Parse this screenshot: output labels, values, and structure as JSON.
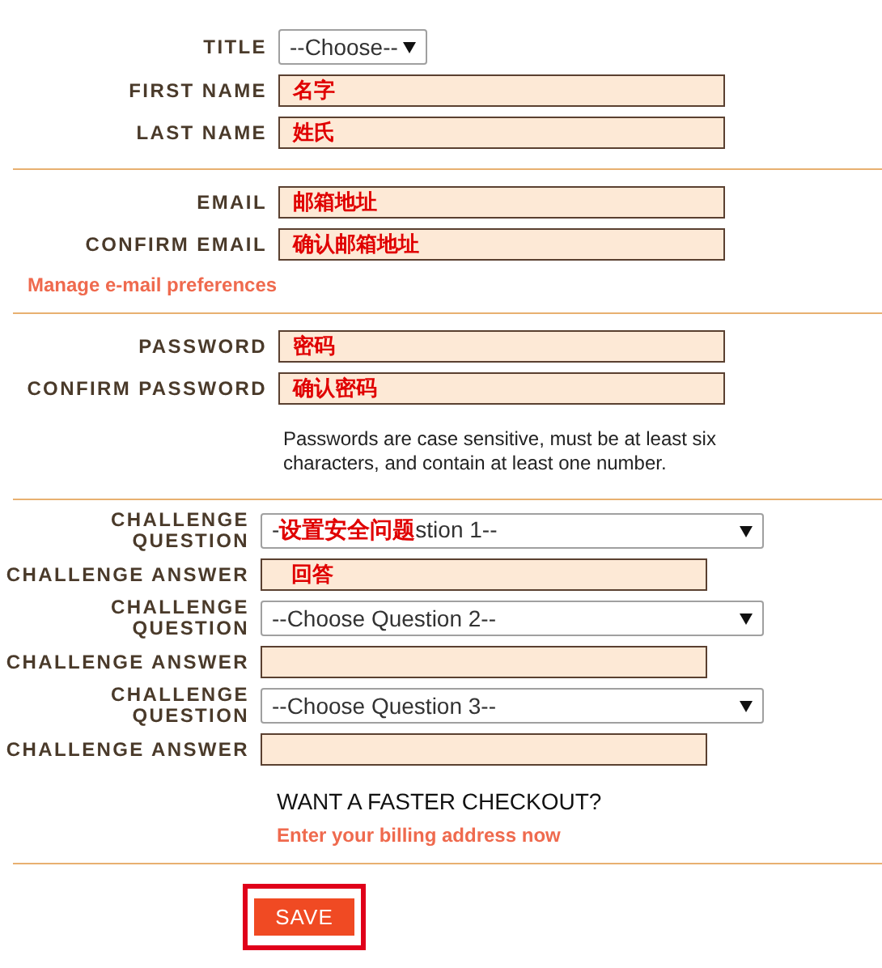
{
  "personal": [
    {
      "label": "TITLE",
      "kind": "select",
      "value": "--Choose--"
    },
    {
      "label": "FIRST NAME",
      "kind": "input",
      "value": "名字"
    },
    {
      "label": "LAST NAME",
      "kind": "input",
      "value": "姓氏"
    }
  ],
  "email": [
    {
      "label": "EMAIL",
      "kind": "input",
      "value": "邮箱地址"
    },
    {
      "label": "CONFIRM EMAIL",
      "kind": "input",
      "value": "确认邮箱地址"
    }
  ],
  "email_link": "Manage e-mail preferences",
  "password": [
    {
      "label": "PASSWORD",
      "kind": "input",
      "value": "密码"
    },
    {
      "label": "CONFIRM PASSWORD",
      "kind": "input",
      "value": "确认密码"
    }
  ],
  "password_hint": "Passwords are case sensitive, must be at least six characters, and contain at least one number.",
  "challenges": [
    {
      "question_label": "CHALLENGE QUESTION",
      "question_before": "-",
      "question_annotation": "设置安全问题",
      "question_after": "stion 1--",
      "answer_label": "CHALLENGE ANSWER",
      "answer": "回答"
    },
    {
      "question_label": "CHALLENGE QUESTION",
      "question_after": "--Choose Question 2--",
      "answer_label": "CHALLENGE ANSWER"
    },
    {
      "question_label": "CHALLENGE QUESTION",
      "question_after": "--Choose Question 3--",
      "answer_label": "CHALLENGE ANSWER"
    }
  ],
  "checkout": {
    "heading": "WANT A FASTER CHECKOUT?",
    "link": "Enter your billing address now"
  },
  "save_button": "SAVE"
}
